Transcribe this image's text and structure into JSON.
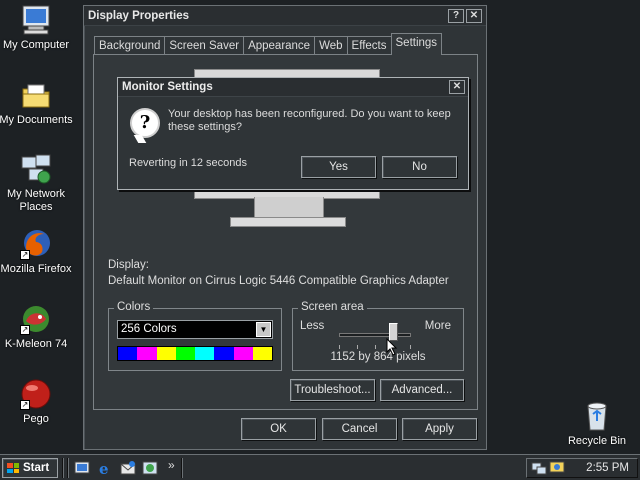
{
  "desktop": {
    "icons": [
      {
        "label": "My Computer"
      },
      {
        "label": "My Documents"
      },
      {
        "label": "My Network Places"
      },
      {
        "label": "Mozilla Firefox"
      },
      {
        "label": "K-Meleon 74"
      },
      {
        "label": "Pego"
      },
      {
        "label": "Recycle Bin"
      }
    ]
  },
  "window": {
    "title": "Display Properties",
    "help_label": "?",
    "close_label": "✕",
    "tabs": [
      "Background",
      "Screen Saver",
      "Appearance",
      "Web",
      "Effects",
      "Settings"
    ],
    "active_tab": "Settings",
    "display_label": "Display:",
    "display_value": "Default Monitor on Cirrus Logic 5446 Compatible Graphics Adapter",
    "colors": {
      "legend": "Colors",
      "selected": "256 Colors",
      "palette": [
        "#0000ff",
        "#ff00ff",
        "#ffff00",
        "#00ff00",
        "#00ffff",
        "#0000ff",
        "#ff00ff",
        "#ffff00"
      ]
    },
    "screen_area": {
      "legend": "Screen area",
      "less_label": "Less",
      "more_label": "More",
      "value": "1152 by 864 pixels",
      "slider_level": 0.75
    },
    "buttons": {
      "troubleshoot": "Troubleshoot...",
      "advanced": "Advanced...",
      "ok": "OK",
      "cancel": "Cancel",
      "apply": "Apply"
    }
  },
  "dialog": {
    "title": "Monitor Settings",
    "close_label": "✕",
    "message": "Your desktop has been reconfigured.  Do you want to keep these settings?",
    "countdown": "Reverting in 12 seconds",
    "yes_label": "Yes",
    "no_label": "No"
  },
  "taskbar": {
    "start_label": "Start",
    "chevron": "»",
    "clock": "2:55 PM"
  }
}
